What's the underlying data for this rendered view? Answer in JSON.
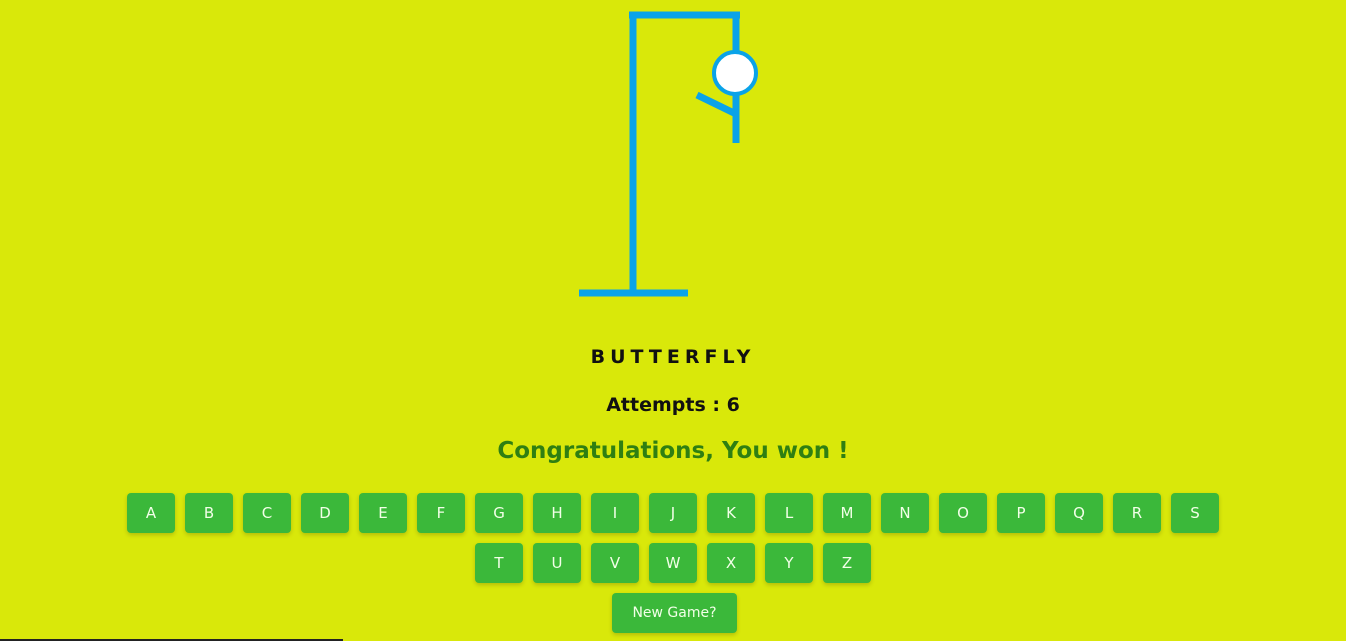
{
  "game": {
    "word": "BUTTERFLY",
    "attempts_text": "Attempts : 6",
    "result_message": "Congratulations, You won !",
    "new_game_label": "New Game?"
  },
  "keyboard": {
    "row1": [
      "A",
      "B",
      "C",
      "D",
      "E",
      "F",
      "G",
      "H",
      "I",
      "J",
      "K",
      "L",
      "M",
      "N",
      "O",
      "P",
      "Q",
      "R",
      "S"
    ],
    "row2": [
      "T",
      "U",
      "V",
      "W",
      "X",
      "Y",
      "Z"
    ]
  },
  "colors": {
    "background": "#d9e80a",
    "gallows": "#0aa3e8",
    "head_fill": "#ffffff",
    "button": "#3bb83a",
    "button_text": "#f2ffe8",
    "result_text": "#2f7f12"
  }
}
